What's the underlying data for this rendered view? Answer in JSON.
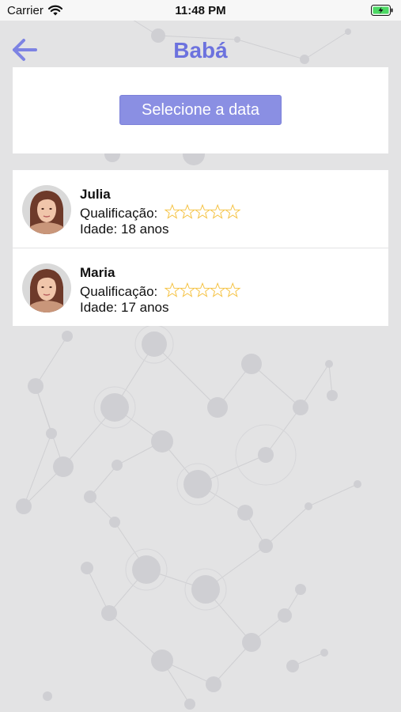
{
  "status_bar": {
    "carrier": "Carrier",
    "time": "11:48 PM",
    "wifi_icon": "wifi-icon",
    "battery_icon": "battery-charging-icon",
    "battery_color": "#4cd964"
  },
  "nav": {
    "title": "Babá",
    "back_icon": "arrow-left-icon",
    "accent_color": "#6c72de"
  },
  "date_picker": {
    "button_label": "Selecione a data",
    "button_color": "#8a8fe3"
  },
  "babysitters": [
    {
      "name": "Julia",
      "rating_label": "Qualificação:",
      "rating_stars": 0,
      "rating_max": 5,
      "age_text": "Idade: 18 anos",
      "avatar_icon": "avatar-photo"
    },
    {
      "name": "Maria",
      "rating_label": "Qualificação:",
      "rating_stars": 0,
      "rating_max": 5,
      "age_text": "Idade: 17 anos",
      "avatar_icon": "avatar-photo"
    }
  ],
  "star_color": "#f5c242"
}
